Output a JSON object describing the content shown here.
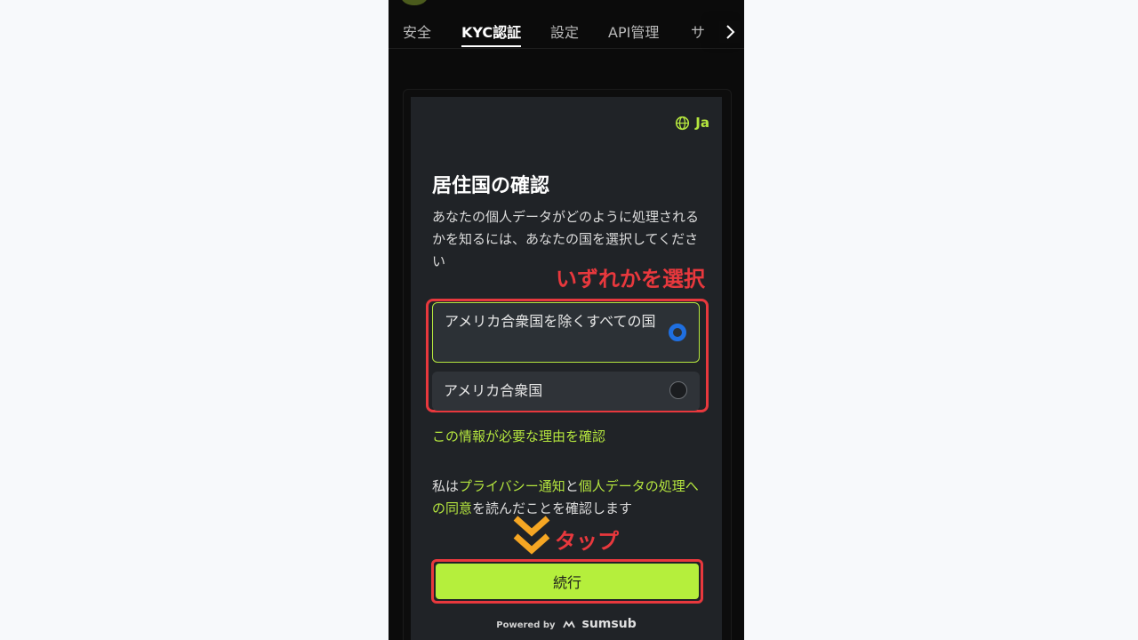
{
  "tabs": [
    {
      "label": "安全",
      "active": false
    },
    {
      "label": "KYC認証",
      "active": true
    },
    {
      "label": "設定",
      "active": false
    },
    {
      "label": "API管理",
      "active": false
    },
    {
      "label": "サ",
      "active": false
    }
  ],
  "language": {
    "label": "Ja",
    "icon": "globe-icon"
  },
  "kyc": {
    "title": "居住国の確認",
    "description": "あなたの個人データがどのように処理されるかを知るには、あなたの国を選択してください",
    "options": [
      {
        "label": "アメリカ合衆国を除くすべての国",
        "selected": true
      },
      {
        "label": "アメリカ合衆国",
        "selected": false
      }
    ],
    "why_link": "この情報が必要な理由を確認",
    "consent": {
      "prefix": "私は",
      "privacy_link": "プライバシー通知",
      "mid": "と",
      "data_link": "個人データの処理への同意",
      "suffix": "を読んだことを確認します"
    },
    "continue_label": "続行",
    "powered_by": "Powered by",
    "brand": "sumsub"
  },
  "annotations": {
    "select_hint": "いずれかを選択",
    "tap_hint": "タップ"
  },
  "colors": {
    "accent": "#b5ef3c",
    "annotation": "#e8383d",
    "radio_selected": "#1f6fe0",
    "arrow": "#f5a623"
  }
}
